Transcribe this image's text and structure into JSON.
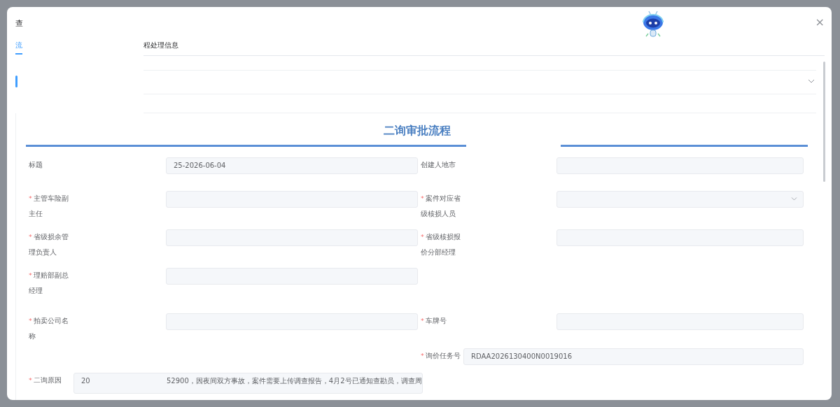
{
  "dialog": {
    "title": "查",
    "close": "×"
  },
  "tabs": [
    {
      "label": "流",
      "selected": true
    },
    {
      "label": "程处理信息",
      "selected": false
    }
  ],
  "section": {
    "title": "二询审批流程"
  },
  "form": {
    "rows": [
      {
        "left": {
          "label": "标题",
          "required": false,
          "kind": "input",
          "value": "25-2026-06-04"
        },
        "right": [
          {
            "label": "创建人地市",
            "required": false,
            "kind": "input"
          }
        ]
      },
      {
        "left": {
          "label": "主管车险副主任",
          "required": true,
          "mark": "*",
          "kind": "input"
        },
        "right": [
          {
            "label": "案件对应省级核损人员",
            "required": true,
            "mark": "*",
            "kind": "select"
          }
        ]
      },
      {
        "left": {
          "label": "省级损余管理负责人",
          "required": true,
          "mark": "*",
          "kind": "input"
        },
        "right": [
          {
            "label": "省级核损报价分部经理",
            "required": true,
            "mark": "*",
            "kind": "input"
          }
        ]
      },
      {
        "left": {
          "label": "理赔部副总经理",
          "required": true,
          "mark": "*",
          "kind": "input"
        },
        "right": []
      },
      {
        "left": {
          "label": "拍卖公司名称",
          "required": true,
          "mark": "*",
          "kind": "input"
        },
        "right": [
          {
            "label": "车牌号",
            "required": true,
            "mark": "*",
            "kind": "input"
          },
          {
            "label": "询价任务号",
            "required": true,
            "mark": "*",
            "kind": "input",
            "value": "RDAA2026130400N0019016"
          }
        ]
      },
      {
        "left": {
          "label": "二询原因",
          "required": true,
          "mark": "*",
          "kind": "textarea",
          "value_parts": [
            "20",
            "52900，因夜间双方事故，案件需要上传调查报告，4月2号已通知查勘员，调查周"
          ]
        },
        "right": []
      }
    ]
  }
}
